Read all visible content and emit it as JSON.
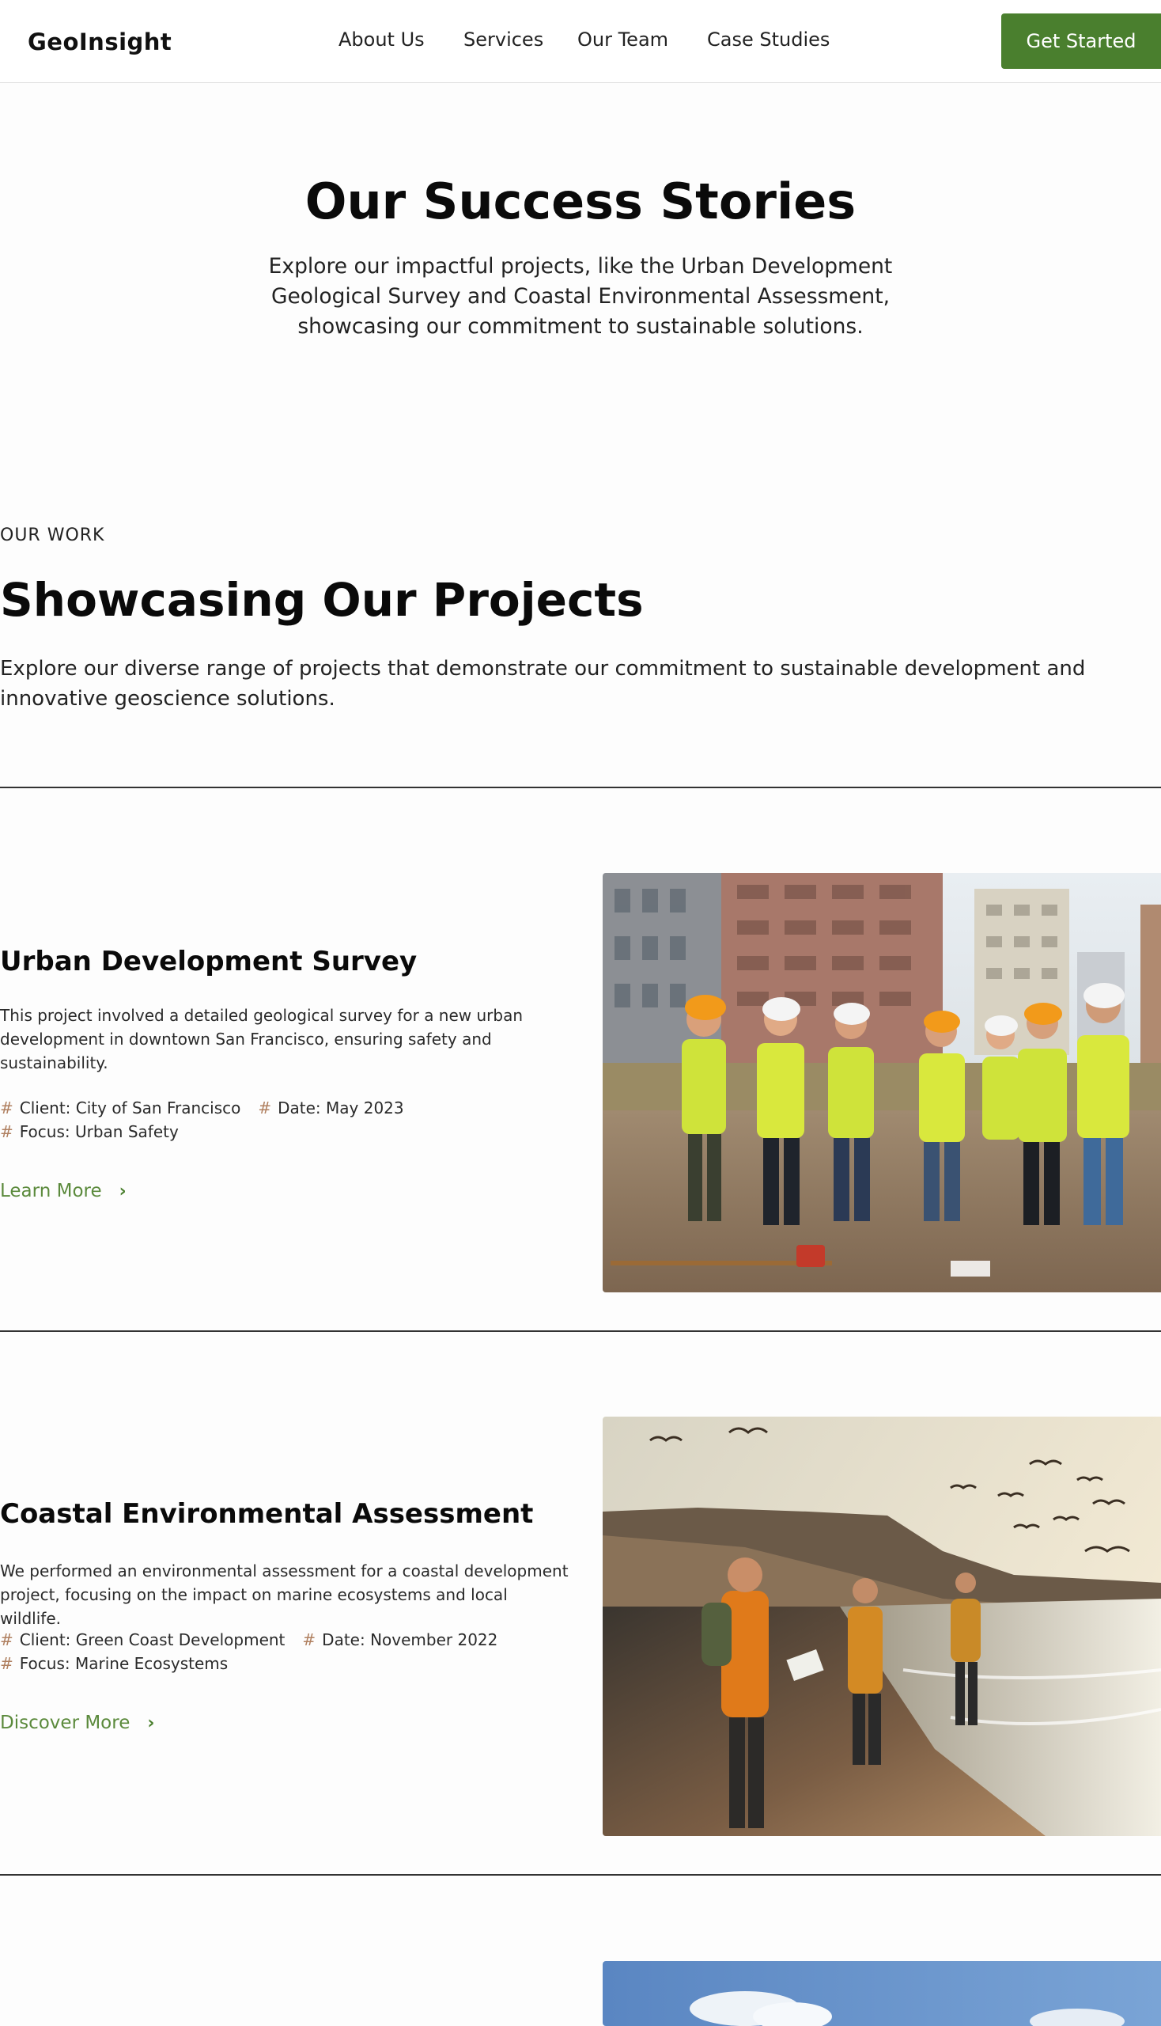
{
  "header": {
    "logo": "GeoInsight",
    "nav": [
      "About Us",
      "Services",
      "Our Team",
      "Case Studies"
    ],
    "cta_label": "Get Started"
  },
  "hero": {
    "title": "Our Success Stories",
    "subtitle": "Explore our impactful projects, like the Urban Development Geological Survey and Coastal Environmental Assessment, showcasing our commitment to sustainable solutions."
  },
  "projects_section": {
    "eyebrow": "OUR WORK",
    "title": "Showcasing Our Projects",
    "subtitle": "Explore our diverse range of projects that demonstrate our commitment to sustainable development and innovative geoscience solutions."
  },
  "projects": [
    {
      "title": "Urban Development Survey",
      "description": "This project involved a detailed geological survey for a new urban development in downtown San Francisco, ensuring safety and sustainability.",
      "client": "Client: City of San Francisco",
      "date": "Date: May 2023",
      "focus": "Focus: Urban Safety",
      "link_label": "Learn More",
      "image": "photo-construction-survey-team"
    },
    {
      "title": "Coastal Environmental Assessment",
      "description": "We performed an environmental assessment for a coastal development project, focusing on the impact on marine ecosystems and local wildlife.",
      "client": "Client: Green Coast Development",
      "date": "Date: November 2022",
      "focus": "Focus: Marine Ecosystems",
      "link_label": "Discover More",
      "image": "photo-coastal-field-team"
    }
  ],
  "icons": {
    "meta_marker": "hash-icon",
    "link_arrow": "chevron-right-icon"
  },
  "colors": {
    "accent": "#4a7f2e",
    "link": "#5b8a3c",
    "meta_marker": "#b08060"
  }
}
